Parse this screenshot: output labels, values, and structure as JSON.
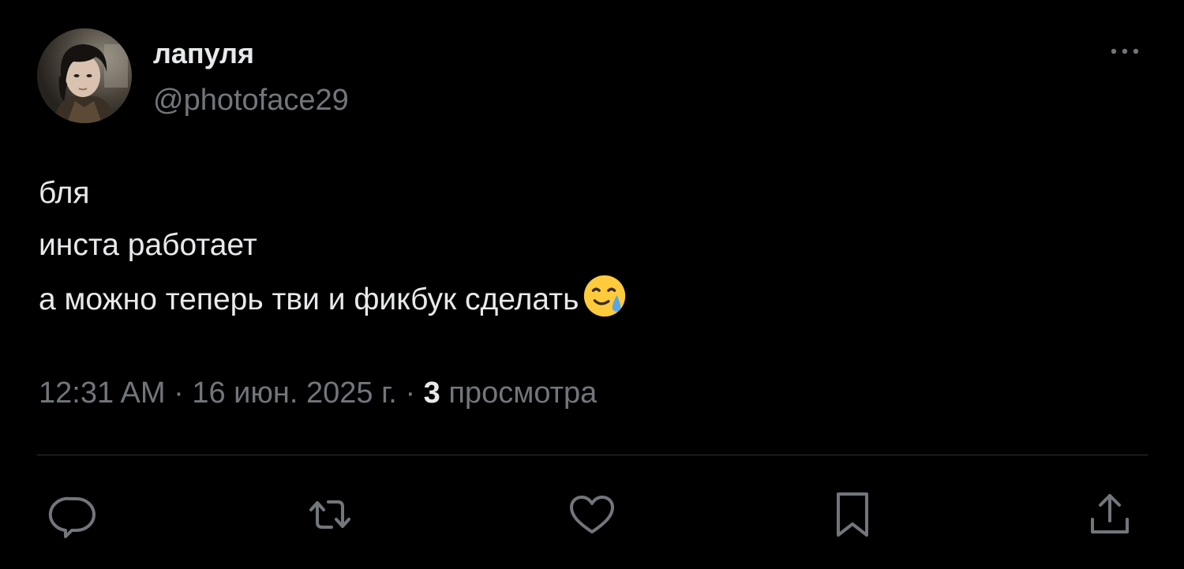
{
  "author": {
    "display_name": "лапуля",
    "handle": "@photoface29",
    "avatar_icon": "user-avatar-photo"
  },
  "tweet": {
    "lines": [
      "бля",
      "инста работает",
      "а можно теперь тви и фикбук сделать"
    ],
    "emoji": "face-holding-back-tears-emoji"
  },
  "meta": {
    "time": "12:31 AM",
    "separator": "·",
    "date": "16 июн. 2025 г.",
    "views_count": "3",
    "views_label": "просмотра"
  },
  "actions": {
    "reply_icon": "reply-icon",
    "retweet_icon": "retweet-icon",
    "like_icon": "heart-icon",
    "bookmark_icon": "bookmark-icon",
    "share_icon": "share-icon"
  },
  "more_icon": "more-options-icon",
  "colors": {
    "background": "#000000",
    "primary_text": "#e7e9ea",
    "secondary_text": "#71767b",
    "divider": "#2f3336"
  }
}
